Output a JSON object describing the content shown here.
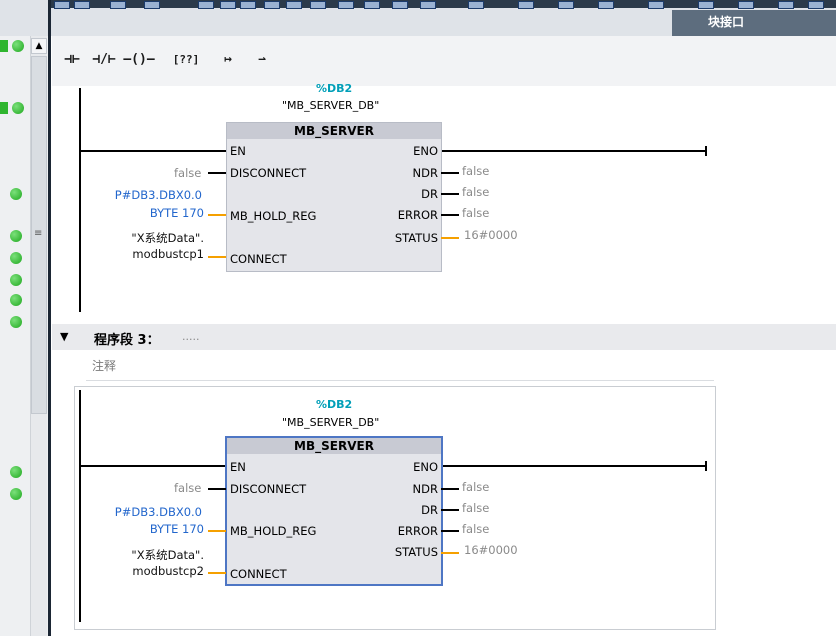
{
  "toolbar": {
    "block_interface": "块接口"
  },
  "lad_bar": {
    "buttons": [
      {
        "name": "no-contact-button",
        "glyph": "⊣⊢"
      },
      {
        "name": "nc-contact-button",
        "glyph": "⊣/⊢"
      },
      {
        "name": "coil-button",
        "glyph": "–()–"
      },
      {
        "name": "empty-box-button",
        "glyph": "[??]"
      },
      {
        "name": "open-branch-button",
        "glyph": "↦"
      },
      {
        "name": "close-branch-button",
        "glyph": "⇀"
      }
    ]
  },
  "network2": {
    "db_number": "%DB2",
    "db_name": "\"MB_SERVER_DB\"",
    "block_name": "MB_SERVER",
    "inputs": {
      "en": "EN",
      "disconnect": "DISCONNECT",
      "mb_hold_reg": "MB_HOLD_REG",
      "connect": "CONNECT"
    },
    "outputs": {
      "eno": "ENO",
      "ndr": "NDR",
      "dr": "DR",
      "error": "ERROR",
      "status": "STATUS"
    },
    "input_values": {
      "disconnect": "false",
      "hold_reg_line1": "P#DB3.DBX0.0",
      "hold_reg_line2": "BYTE 170",
      "connect_line1": "\"X系统Data\".",
      "connect_line2": "modbustcp1"
    },
    "output_values": {
      "ndr": "false",
      "dr": "false",
      "error": "false",
      "status": "16#0000"
    }
  },
  "network3": {
    "header_title": "程序段 3：",
    "header_dots": ".....",
    "comment": "注释",
    "db_number": "%DB2",
    "db_name": "\"MB_SERVER_DB\"",
    "block_name": "MB_SERVER",
    "inputs": {
      "en": "EN",
      "disconnect": "DISCONNECT",
      "mb_hold_reg": "MB_HOLD_REG",
      "connect": "CONNECT"
    },
    "outputs": {
      "eno": "ENO",
      "ndr": "NDR",
      "dr": "DR",
      "error": "ERROR",
      "status": "STATUS"
    },
    "input_values": {
      "disconnect": "false",
      "hold_reg_line1": "P#DB3.DBX0.0",
      "hold_reg_line2": "BYTE 170",
      "connect_line1": "\"X系统Data\".",
      "connect_line2": "modbustcp2"
    },
    "output_values": {
      "ndr": "false",
      "dr": "false",
      "error": "false",
      "status": "16#0000"
    }
  },
  "colors": {
    "db_accent": "#009fb8",
    "param_blue": "#2266cc",
    "status_orange": "#f5a000",
    "selection_blue": "#4e76c4",
    "status_led_green": "#1ea81e"
  }
}
